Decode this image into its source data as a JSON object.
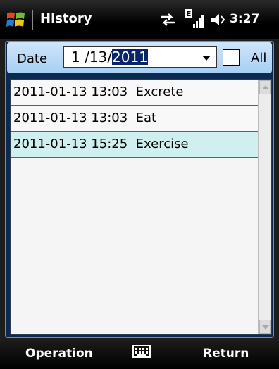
{
  "titlebar": {
    "title": "History",
    "time": "3:27",
    "icons": [
      "windows-start-icon",
      "sync-icon",
      "signal-icon",
      "sound-icon"
    ]
  },
  "filter": {
    "date_label": "Date",
    "date_value_prefix": "1 /13/",
    "date_value_selected": "2011",
    "all_label": "All",
    "all_checked": false
  },
  "history": {
    "rows": [
      {
        "text": "2011-01-13 13:03  Excrete",
        "selected": false
      },
      {
        "text": "2011-01-13 13:03  Eat",
        "selected": false
      },
      {
        "text": "2011-01-13 15:25  Exercise",
        "selected": true
      }
    ]
  },
  "softkeys": {
    "left": "Operation",
    "right": "Return"
  },
  "colors": {
    "selection": "#0a246a",
    "row_selected": "#d0f0f0",
    "header_bg": "#a7cff4"
  }
}
